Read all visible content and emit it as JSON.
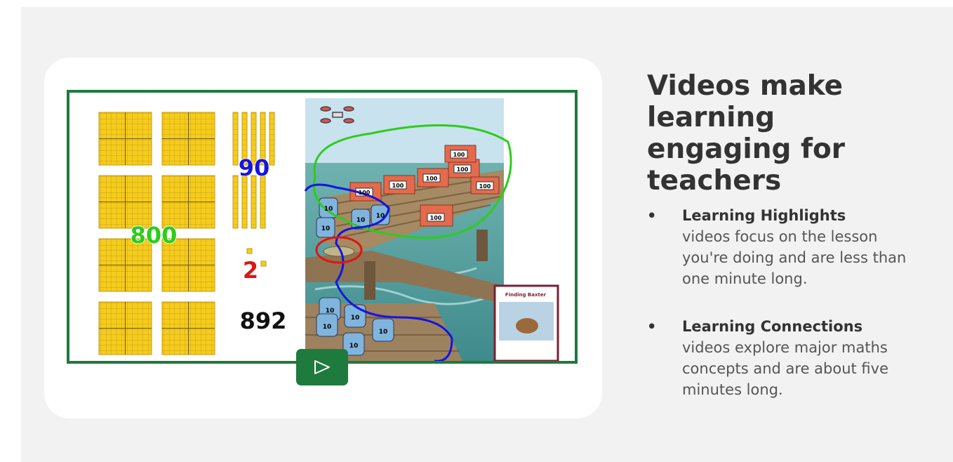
{
  "section": {
    "heading": "Videos make learning engaging for teachers",
    "bullets": [
      {
        "title": "Learning Highlights",
        "description": "videos focus on the lesson you're doing and are less than one minute long."
      },
      {
        "title": "Learning Connections",
        "description": "videos explore major maths concepts and are about five minutes long."
      }
    ]
  },
  "video": {
    "labels": {
      "hundreds": "800",
      "tens": "90",
      "ones": "2",
      "total": "892"
    },
    "crate_label": "100",
    "tub_label": "10",
    "book_title": "Finding Baxter",
    "play_icon": "play-icon"
  },
  "colors": {
    "brand_green": "#1f7a3d",
    "block_yellow": "#f4c81a",
    "hundreds_green": "#2ecc1a",
    "tens_blue": "#1414e0",
    "ones_red": "#e01414"
  }
}
